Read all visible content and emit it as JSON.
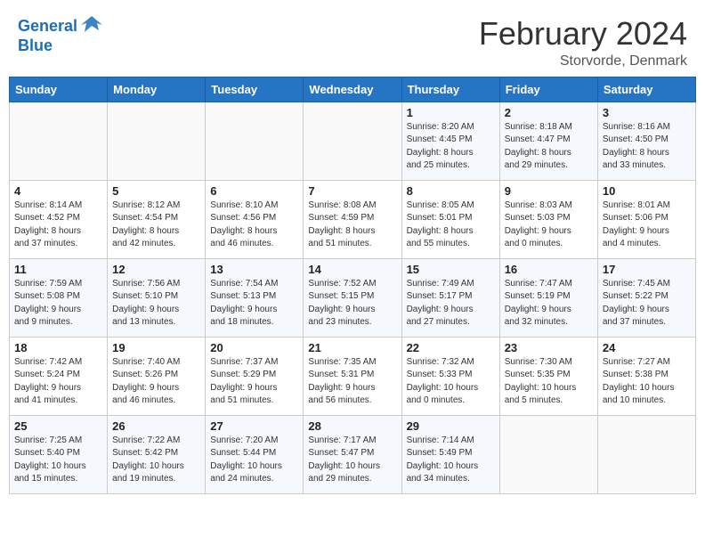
{
  "header": {
    "logo_line1": "General",
    "logo_line2": "Blue",
    "month_year": "February 2024",
    "location": "Storvorde, Denmark"
  },
  "weekdays": [
    "Sunday",
    "Monday",
    "Tuesday",
    "Wednesday",
    "Thursday",
    "Friday",
    "Saturday"
  ],
  "rows": [
    [
      {
        "day": "",
        "text": ""
      },
      {
        "day": "",
        "text": ""
      },
      {
        "day": "",
        "text": ""
      },
      {
        "day": "",
        "text": ""
      },
      {
        "day": "1",
        "text": "Sunrise: 8:20 AM\nSunset: 4:45 PM\nDaylight: 8 hours\nand 25 minutes."
      },
      {
        "day": "2",
        "text": "Sunrise: 8:18 AM\nSunset: 4:47 PM\nDaylight: 8 hours\nand 29 minutes."
      },
      {
        "day": "3",
        "text": "Sunrise: 8:16 AM\nSunset: 4:50 PM\nDaylight: 8 hours\nand 33 minutes."
      }
    ],
    [
      {
        "day": "4",
        "text": "Sunrise: 8:14 AM\nSunset: 4:52 PM\nDaylight: 8 hours\nand 37 minutes."
      },
      {
        "day": "5",
        "text": "Sunrise: 8:12 AM\nSunset: 4:54 PM\nDaylight: 8 hours\nand 42 minutes."
      },
      {
        "day": "6",
        "text": "Sunrise: 8:10 AM\nSunset: 4:56 PM\nDaylight: 8 hours\nand 46 minutes."
      },
      {
        "day": "7",
        "text": "Sunrise: 8:08 AM\nSunset: 4:59 PM\nDaylight: 8 hours\nand 51 minutes."
      },
      {
        "day": "8",
        "text": "Sunrise: 8:05 AM\nSunset: 5:01 PM\nDaylight: 8 hours\nand 55 minutes."
      },
      {
        "day": "9",
        "text": "Sunrise: 8:03 AM\nSunset: 5:03 PM\nDaylight: 9 hours\nand 0 minutes."
      },
      {
        "day": "10",
        "text": "Sunrise: 8:01 AM\nSunset: 5:06 PM\nDaylight: 9 hours\nand 4 minutes."
      }
    ],
    [
      {
        "day": "11",
        "text": "Sunrise: 7:59 AM\nSunset: 5:08 PM\nDaylight: 9 hours\nand 9 minutes."
      },
      {
        "day": "12",
        "text": "Sunrise: 7:56 AM\nSunset: 5:10 PM\nDaylight: 9 hours\nand 13 minutes."
      },
      {
        "day": "13",
        "text": "Sunrise: 7:54 AM\nSunset: 5:13 PM\nDaylight: 9 hours\nand 18 minutes."
      },
      {
        "day": "14",
        "text": "Sunrise: 7:52 AM\nSunset: 5:15 PM\nDaylight: 9 hours\nand 23 minutes."
      },
      {
        "day": "15",
        "text": "Sunrise: 7:49 AM\nSunset: 5:17 PM\nDaylight: 9 hours\nand 27 minutes."
      },
      {
        "day": "16",
        "text": "Sunrise: 7:47 AM\nSunset: 5:19 PM\nDaylight: 9 hours\nand 32 minutes."
      },
      {
        "day": "17",
        "text": "Sunrise: 7:45 AM\nSunset: 5:22 PM\nDaylight: 9 hours\nand 37 minutes."
      }
    ],
    [
      {
        "day": "18",
        "text": "Sunrise: 7:42 AM\nSunset: 5:24 PM\nDaylight: 9 hours\nand 41 minutes."
      },
      {
        "day": "19",
        "text": "Sunrise: 7:40 AM\nSunset: 5:26 PM\nDaylight: 9 hours\nand 46 minutes."
      },
      {
        "day": "20",
        "text": "Sunrise: 7:37 AM\nSunset: 5:29 PM\nDaylight: 9 hours\nand 51 minutes."
      },
      {
        "day": "21",
        "text": "Sunrise: 7:35 AM\nSunset: 5:31 PM\nDaylight: 9 hours\nand 56 minutes."
      },
      {
        "day": "22",
        "text": "Sunrise: 7:32 AM\nSunset: 5:33 PM\nDaylight: 10 hours\nand 0 minutes."
      },
      {
        "day": "23",
        "text": "Sunrise: 7:30 AM\nSunset: 5:35 PM\nDaylight: 10 hours\nand 5 minutes."
      },
      {
        "day": "24",
        "text": "Sunrise: 7:27 AM\nSunset: 5:38 PM\nDaylight: 10 hours\nand 10 minutes."
      }
    ],
    [
      {
        "day": "25",
        "text": "Sunrise: 7:25 AM\nSunset: 5:40 PM\nDaylight: 10 hours\nand 15 minutes."
      },
      {
        "day": "26",
        "text": "Sunrise: 7:22 AM\nSunset: 5:42 PM\nDaylight: 10 hours\nand 19 minutes."
      },
      {
        "day": "27",
        "text": "Sunrise: 7:20 AM\nSunset: 5:44 PM\nDaylight: 10 hours\nand 24 minutes."
      },
      {
        "day": "28",
        "text": "Sunrise: 7:17 AM\nSunset: 5:47 PM\nDaylight: 10 hours\nand 29 minutes."
      },
      {
        "day": "29",
        "text": "Sunrise: 7:14 AM\nSunset: 5:49 PM\nDaylight: 10 hours\nand 34 minutes."
      },
      {
        "day": "",
        "text": ""
      },
      {
        "day": "",
        "text": ""
      }
    ]
  ]
}
